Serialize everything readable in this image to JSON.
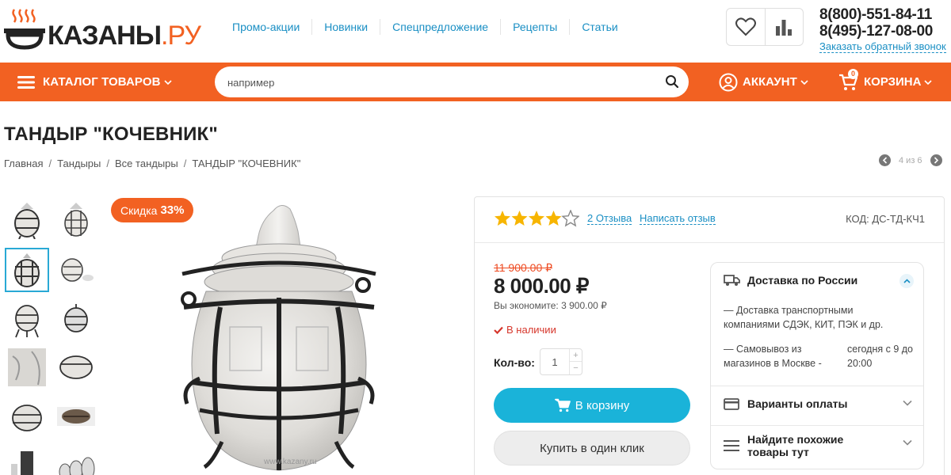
{
  "header": {
    "logo_text": "КАЗАНЫ",
    "logo_suffix": ".РУ",
    "nav": [
      "Промо-акции",
      "Новинки",
      "Спецпредложение",
      "Рецепты",
      "Статьи"
    ],
    "phone_1": "8(800)-551-84-11",
    "phone_2": "8(495)-127-08-00",
    "callback": "Заказать обратный звонок",
    "wishlist_icon": "heart-icon",
    "compare_icon": "bar-chart-icon"
  },
  "menubar": {
    "catalog_label": "КАТАЛОГ ТОВАРОВ",
    "search_placeholder": "например",
    "account_label": "АККАУНТ",
    "cart_label": "КОРЗИНА",
    "cart_count": "0",
    "accent": "#f26122"
  },
  "product": {
    "title": "ТАНДЫР \"КОЧЕВНИК\"",
    "breadcrumb": [
      "Главная",
      "Тандыры",
      "Все тандыры",
      "ТАНДЫР \"КОЧЕВНИК\""
    ],
    "pager": "4 из 6",
    "discount_label": "Скидка",
    "discount_value": "33%",
    "watermark": "www.kazany.ru",
    "rating": 4,
    "rating_max": 5,
    "reviews_link": "2 Отзыва",
    "write_review": "Написать отзыв",
    "sku": "КОД: ДС-ТД-КЧ1",
    "old_price": "11 900.00 ₽",
    "price": "8 000.00 ₽",
    "savings": "Вы экономите: 3 900.00 ₽",
    "stock": "В наличии",
    "qty_label": "Кол-во:",
    "qty_value": "1",
    "add_to_cart": "В корзину",
    "buy_one_click": "Купить в один клик"
  },
  "delivery": {
    "title": "Доставка по России",
    "line1": "— Доставка транспортными компаниями СДЭК, КИТ, ПЭК и др.",
    "line2_left": "— Самовывоз из магазинов в Москве -",
    "line2_right": "сегодня с 9 до 20:00",
    "payment": "Варианты оплаты",
    "similar": "Найдите похожие товары тут"
  }
}
